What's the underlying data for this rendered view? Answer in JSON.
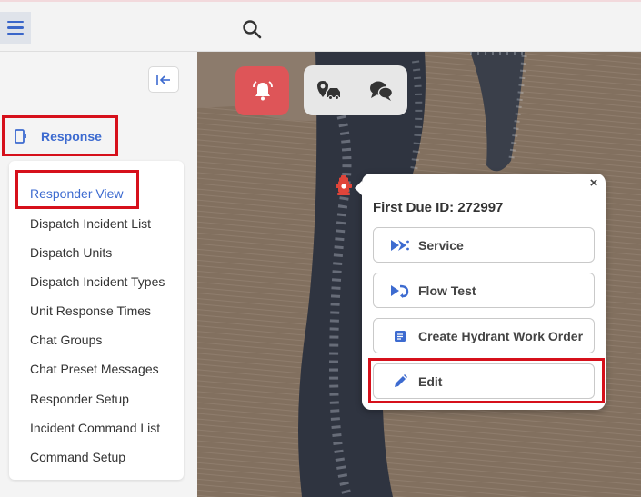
{
  "topbar": {
    "menu_icon": "hamburger-icon",
    "search_icon": "search-icon"
  },
  "sidebar": {
    "collapse_icon": "collapse-left-icon",
    "section": {
      "label": "Response",
      "icon": "device-icon"
    },
    "items": [
      {
        "label": "Responder View",
        "active": true
      },
      {
        "label": "Dispatch Incident List"
      },
      {
        "label": "Dispatch Units"
      },
      {
        "label": "Dispatch Incident Types"
      },
      {
        "label": "Unit Response Times"
      },
      {
        "label": "Chat Groups"
      },
      {
        "label": "Chat Preset Messages"
      },
      {
        "label": "Responder Setup"
      },
      {
        "label": "Incident Command List"
      },
      {
        "label": "Command Setup"
      }
    ]
  },
  "map_tools": {
    "alert_icon": "bell-alert-icon",
    "tools": [
      "map-marker-car-icon",
      "chat-bubbles-icon"
    ]
  },
  "popup": {
    "title": "First Due ID: 272997",
    "close": "×",
    "actions": [
      {
        "label": "Service",
        "icon": "service-icon"
      },
      {
        "label": "Flow Test",
        "icon": "flow-test-icon"
      },
      {
        "label": "Create Hydrant Work Order",
        "icon": "work-order-icon"
      },
      {
        "label": "Edit",
        "icon": "pencil-icon"
      }
    ]
  },
  "colors": {
    "accent": "#3d6bd0",
    "alert": "#de5558",
    "highlight": "#d6101b"
  }
}
